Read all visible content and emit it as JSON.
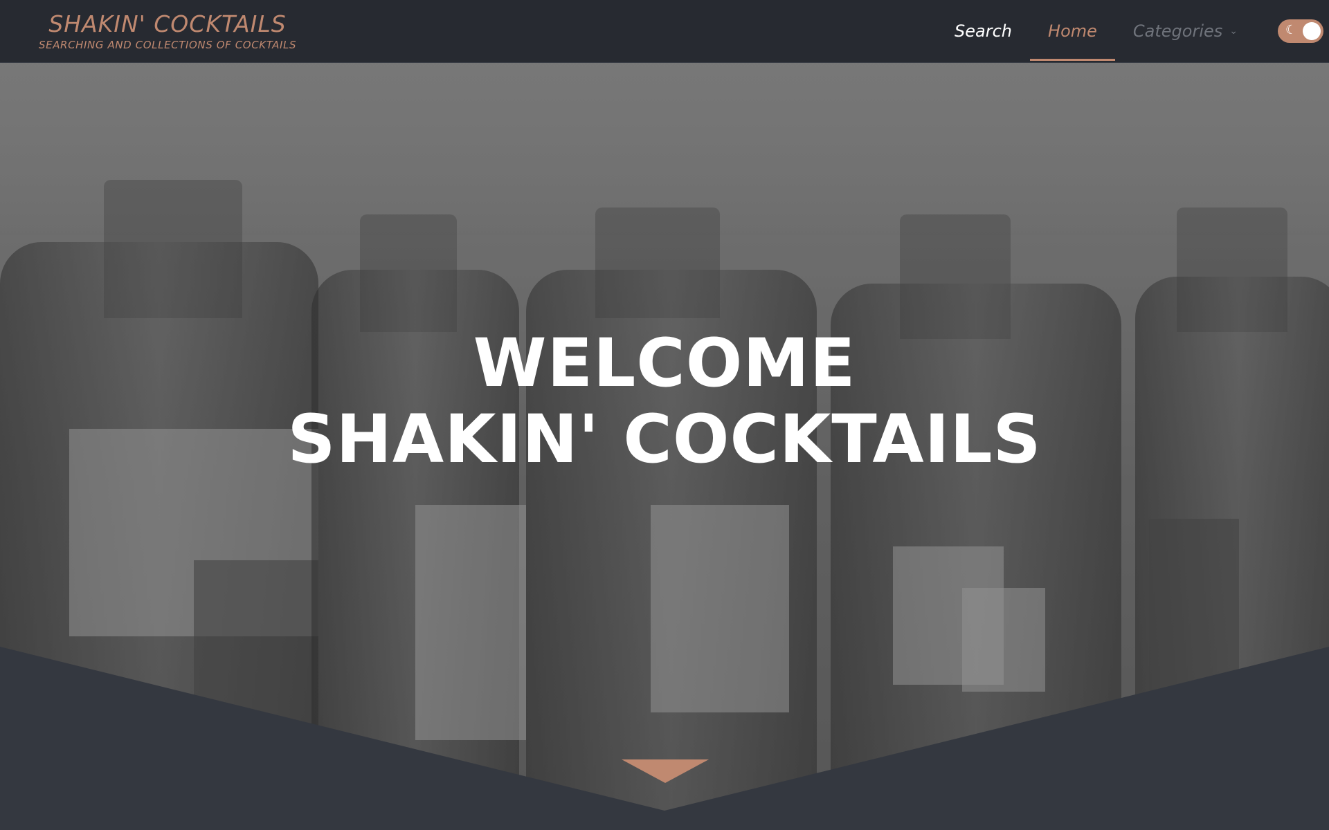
{
  "brand": {
    "title": "SHAKIN' COCKTAILS",
    "tagline": "SEARCHING AND COLLECTIONS OF COCKTAILS"
  },
  "nav": {
    "search": "Search",
    "home": "Home",
    "categories": "Categories",
    "active": "Home"
  },
  "theme_toggle": {
    "icon": "moon-icon",
    "state": "on"
  },
  "hero": {
    "line1": "WELCOME",
    "line2": "SHAKIN' COCKTAILS"
  },
  "colors": {
    "accent": "#c08970",
    "navbar": "#272a31",
    "footer_band": "#343840"
  }
}
